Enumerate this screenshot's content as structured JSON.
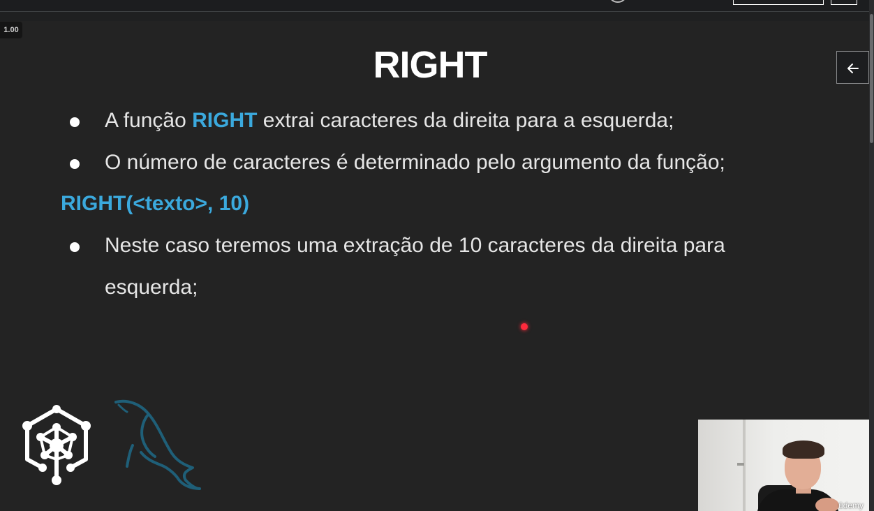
{
  "player": {
    "speed_label": "1.00",
    "back_icon": "arrow-left-icon",
    "watermark": "ūdemy"
  },
  "slide": {
    "title": "RIGHT",
    "bullets": [
      {
        "before": "A função ",
        "highlight": "RIGHT",
        "after": " extrai caracteres da direita para a esquerda;"
      },
      {
        "text": "O número de caracteres é determinado pelo argumento da função;"
      },
      {
        "text": "Neste caso teremos uma extração de 10 caracteres da direita para esquerda;"
      }
    ],
    "syntax": "RIGHT(<texto>, 10)"
  },
  "colors": {
    "background": "#232323",
    "accent": "#3ba9dd",
    "text": "#e6e6e6",
    "laser": "#ff2a3c"
  },
  "logos": [
    "hexagon-network-logo",
    "mysql-dolphin-logo"
  ]
}
